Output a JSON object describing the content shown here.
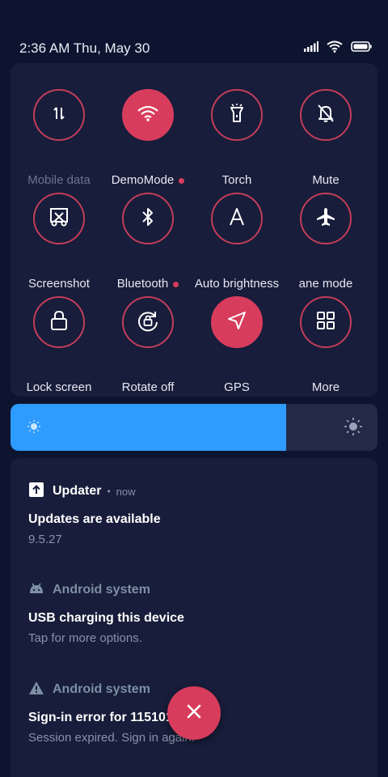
{
  "status_bar": {
    "time": "2:36 AM Thu, May 30",
    "icons": [
      "signal-icon",
      "wifi-icon",
      "battery-icon"
    ]
  },
  "quick_settings": {
    "tiles": [
      {
        "label": "Mobile data",
        "icon": "data-arrows-icon",
        "active": false,
        "dim": true
      },
      {
        "label": "DemoMode",
        "icon": "wifi-icon",
        "active": true,
        "dot": true
      },
      {
        "label": "Torch",
        "icon": "torch-icon",
        "active": false
      },
      {
        "label": "Mute",
        "icon": "bell-off-icon",
        "active": false
      },
      {
        "label": "Screenshot",
        "icon": "scissors-icon",
        "active": false
      },
      {
        "label": "Bluetooth",
        "icon": "bluetooth-icon",
        "active": false,
        "dot": true
      },
      {
        "label": "Auto brightness",
        "icon": "letter-a-icon",
        "active": false
      },
      {
        "label": "ane mode",
        "icon": "airplane-icon",
        "active": false
      },
      {
        "label": "Lock screen",
        "icon": "lock-icon",
        "active": false
      },
      {
        "label": "Rotate off",
        "icon": "rotate-lock-icon",
        "active": false
      },
      {
        "label": "GPS",
        "icon": "location-arrow-icon",
        "active": true
      },
      {
        "label": "More",
        "icon": "grid-icon",
        "active": false
      }
    ]
  },
  "brightness": {
    "level": 0.75,
    "fill_color": "#2e9bff"
  },
  "notifications": [
    {
      "app": "Updater",
      "separator": "•",
      "time": "now",
      "title": "Updates are available",
      "text": "9.5.27",
      "icon": "update-arrow-icon"
    },
    {
      "app": "Android system",
      "title": "USB charging this device",
      "text": "Tap for more options.",
      "icon": "android-icon"
    },
    {
      "app": "Android system",
      "title": "Sign-in error for 115101",
      "text": "Session expired. Sign in again.",
      "icon": "warning-icon"
    }
  ],
  "colors": {
    "accent": "#d83c5c",
    "background": "#0d1430",
    "panel": "#171d3a"
  }
}
